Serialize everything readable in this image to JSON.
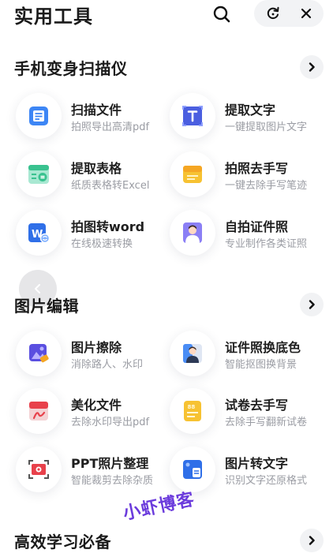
{
  "header": {
    "title": "实用工具"
  },
  "sections": [
    {
      "title": "手机变身扫描仪",
      "tools": [
        {
          "title": "扫描文件",
          "subtitle": "拍照导出高清pdf",
          "icon": "scan-document-icon"
        },
        {
          "title": "提取文字",
          "subtitle": "一键提取图片文字",
          "icon": "text-extract-icon"
        },
        {
          "title": "提取表格",
          "subtitle": "纸质表格转Excel",
          "icon": "table-extract-icon"
        },
        {
          "title": "拍照去手写",
          "subtitle": "一键去除手写笔迹",
          "icon": "remove-handwriting-icon"
        },
        {
          "title": "拍图转word",
          "subtitle": "在线极速转换",
          "icon": "word-convert-icon"
        },
        {
          "title": "自拍证件照",
          "subtitle": "专业制作各类证照",
          "icon": "id-photo-icon"
        }
      ]
    },
    {
      "title": "图片编辑",
      "tools": [
        {
          "title": "图片擦除",
          "subtitle": "消除路人、水印",
          "icon": "image-erase-icon"
        },
        {
          "title": "证件照换底色",
          "subtitle": "智能抠图换背景",
          "icon": "id-background-icon"
        },
        {
          "title": "美化文件",
          "subtitle": "去除水印导出pdf",
          "icon": "beautify-pdf-icon"
        },
        {
          "title": "试卷去手写",
          "subtitle": "去除手写翻新试卷",
          "icon": "exam-clean-icon"
        },
        {
          "title": "PPT照片整理",
          "subtitle": "智能裁剪去除杂质",
          "icon": "ppt-photo-icon"
        },
        {
          "title": "图片转文字",
          "subtitle": "识别文字还原格式",
          "icon": "image-to-text-icon"
        }
      ]
    },
    {
      "title": "高效学习必备",
      "tools": []
    }
  ],
  "watermark": "小虾博客",
  "colors": {
    "blue": "#3a7bf0",
    "yellow": "#f7c232",
    "red": "#e8414b",
    "purple": "#6b3bdc"
  }
}
